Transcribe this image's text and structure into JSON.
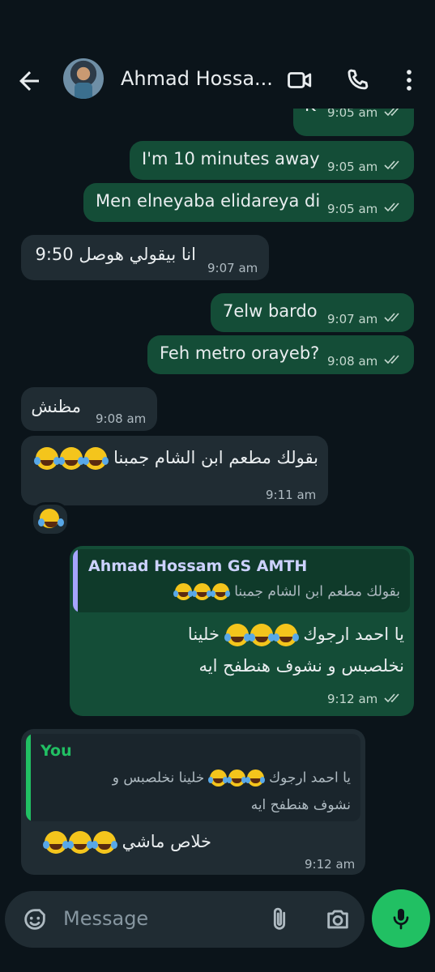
{
  "header": {
    "contact_name": "Ahmad Hossa...",
    "icons": [
      "back-arrow-icon",
      "video-call-icon",
      "phone-icon",
      "more-vert-icon"
    ]
  },
  "messages": [
    {
      "dir": "out",
      "text": "K",
      "time": "9:05 am",
      "status": "read"
    },
    {
      "dir": "out",
      "text": "I'm 10 minutes away",
      "time": "9:05 am",
      "status": "read"
    },
    {
      "dir": "out",
      "text": "Men elneyaba elidareya di",
      "time": "9:05 am",
      "status": "read"
    },
    {
      "dir": "in",
      "text": "انا بيقولي هوصل 9:50",
      "time": "9:07 am"
    },
    {
      "dir": "out",
      "text": "7elw bardo",
      "time": "9:07 am",
      "status": "read"
    },
    {
      "dir": "out",
      "text": "Feh metro orayeb?",
      "time": "9:08 am",
      "status": "read"
    },
    {
      "dir": "in",
      "text": "مظنش",
      "time": "9:08 am"
    },
    {
      "dir": "in",
      "text": "بقولك مطعم ابن الشام جمبنا",
      "time": "9:11 am",
      "emoji_count": 3,
      "reaction": "laughing-tears-emoji"
    },
    {
      "dir": "out",
      "quote_author": "Ahmad Hossam GS AMTH",
      "quote_text": "بقولك مطعم ابن الشام جمبنا",
      "quote_emoji_count": 3,
      "line1": "يا احمد ارجوك",
      "line1_tail": "خلينا",
      "line1_emoji_count": 3,
      "line2": "نخلصبس و نشوف هنطفح ايه",
      "time": "9:12 am",
      "status": "read"
    },
    {
      "dir": "in",
      "quote_author": "You",
      "quote_line1_start": "يا احمد ارجوك",
      "quote_line1_end": "خلينا نخلصبس و",
      "quote_emoji_count": 3,
      "quote_line2": "نشوف هنطفح ايه",
      "text": "خلاص ماشي",
      "emoji_count": 3,
      "time": "9:12 am"
    }
  ],
  "composer": {
    "placeholder": "Message",
    "icons": [
      "sticker-icon",
      "attach-icon",
      "camera-icon",
      "mic-icon"
    ]
  },
  "colors": {
    "background": "#0b141a",
    "outgoing_bubble": "#144d37",
    "incoming_bubble": "#202c33",
    "quote_author_out": "#cdd2ff",
    "quote_author_in": "#21c063",
    "mic_button": "#21c063"
  }
}
